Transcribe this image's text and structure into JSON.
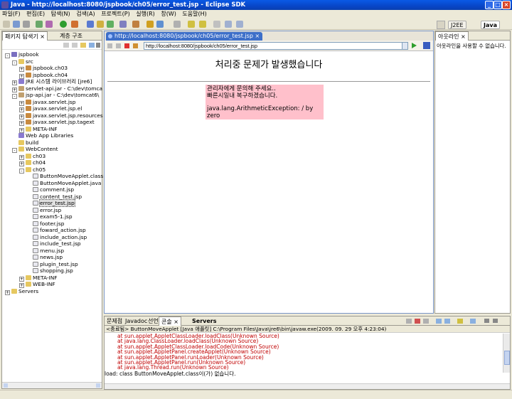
{
  "window": {
    "title": "Java - http://localhost:8080/jspbook/ch05/error_test.jsp - Eclipse SDK"
  },
  "menu": [
    "파일(F)",
    "편집(E)",
    "탐색(N)",
    "검색(A)",
    "프로젝트(P)",
    "실행(R)",
    "창(W)",
    "도움말(H)"
  ],
  "perspectives": {
    "j2ee": "J2EE",
    "java": "Java"
  },
  "left_tabs": [
    "패키지 탐색기",
    "계층 구조"
  ],
  "tree": [
    {
      "label": "jspbook",
      "indent": 0,
      "exp": "-",
      "icon": "project"
    },
    {
      "label": "src",
      "indent": 1,
      "exp": "-",
      "icon": "folder"
    },
    {
      "label": "jspbook.ch03",
      "indent": 2,
      "exp": "+",
      "icon": "package"
    },
    {
      "label": "jspbook.ch04",
      "indent": 2,
      "exp": "+",
      "icon": "package"
    },
    {
      "label": "JRE 시스템 라이브러리 [jre6]",
      "indent": 1,
      "exp": "+",
      "icon": "library"
    },
    {
      "label": "servlet-api.jar - C:\\dev\\tomca",
      "indent": 1,
      "exp": "+",
      "icon": "jar"
    },
    {
      "label": "jsp-api.jar - C:\\dev\\tomcat6\\",
      "indent": 1,
      "exp": "-",
      "icon": "jar"
    },
    {
      "label": "javax.servlet.jsp",
      "indent": 2,
      "exp": "+",
      "icon": "package"
    },
    {
      "label": "javax.servlet.jsp.el",
      "indent": 2,
      "exp": "+",
      "icon": "package"
    },
    {
      "label": "javax.servlet.jsp.resources",
      "indent": 2,
      "exp": "+",
      "icon": "package"
    },
    {
      "label": "javax.servlet.jsp.tagext",
      "indent": 2,
      "exp": "+",
      "icon": "package"
    },
    {
      "label": "META-INF",
      "indent": 2,
      "exp": "+",
      "icon": "folder"
    },
    {
      "label": "Web App Libraries",
      "indent": 1,
      "exp": "",
      "icon": "library"
    },
    {
      "label": "build",
      "indent": 1,
      "exp": "",
      "icon": "folder"
    },
    {
      "label": "WebContent",
      "indent": 1,
      "exp": "-",
      "icon": "folder"
    },
    {
      "label": "ch03",
      "indent": 2,
      "exp": "+",
      "icon": "folder"
    },
    {
      "label": "ch04",
      "indent": 2,
      "exp": "+",
      "icon": "folder"
    },
    {
      "label": "ch05",
      "indent": 2,
      "exp": "-",
      "icon": "folder"
    },
    {
      "label": "ButtonMoveApplet.class",
      "indent": 3,
      "exp": "",
      "icon": "file"
    },
    {
      "label": "ButtonMoveApplet.java",
      "indent": 3,
      "exp": "",
      "icon": "file"
    },
    {
      "label": "comment.jsp",
      "indent": 3,
      "exp": "",
      "icon": "file"
    },
    {
      "label": "content_test.jsp",
      "indent": 3,
      "exp": "",
      "icon": "file"
    },
    {
      "label": "error_test.jsp",
      "indent": 3,
      "exp": "",
      "icon": "file",
      "selected": true
    },
    {
      "label": "error.jsp",
      "indent": 3,
      "exp": "",
      "icon": "file"
    },
    {
      "label": "exam5-1.jsp",
      "indent": 3,
      "exp": "",
      "icon": "file"
    },
    {
      "label": "footer.jsp",
      "indent": 3,
      "exp": "",
      "icon": "file"
    },
    {
      "label": "foward_action.jsp",
      "indent": 3,
      "exp": "",
      "icon": "file"
    },
    {
      "label": "include_action.jsp",
      "indent": 3,
      "exp": "",
      "icon": "file"
    },
    {
      "label": "include_test.jsp",
      "indent": 3,
      "exp": "",
      "icon": "file"
    },
    {
      "label": "menu.jsp",
      "indent": 3,
      "exp": "",
      "icon": "file"
    },
    {
      "label": "news.jsp",
      "indent": 3,
      "exp": "",
      "icon": "file"
    },
    {
      "label": "plugin_test.jsp",
      "indent": 3,
      "exp": "",
      "icon": "file"
    },
    {
      "label": "shopping.jsp",
      "indent": 3,
      "exp": "",
      "icon": "file"
    },
    {
      "label": "META-INF",
      "indent": 2,
      "exp": "+",
      "icon": "folder"
    },
    {
      "label": "WEB-INF",
      "indent": 2,
      "exp": "+",
      "icon": "folder"
    },
    {
      "label": "Servers",
      "indent": 0,
      "exp": "+",
      "icon": "folder"
    }
  ],
  "editor": {
    "tab": "http://localhost:8080/jspbook/ch05/error_test.jsp",
    "url": "http://localhost:8080/jspbook/ch05/error_test.jsp",
    "heading": "처리중 문제가 발생했습니다",
    "msg1": "관리자에게 문의해 주세요..",
    "msg2": "빠른시일내 복구하겠습니다.",
    "exception": "java.lang.ArithmeticException: / by zero"
  },
  "outline": {
    "tab": "아웃라인",
    "message": "아웃라인을 사용할 수 없습니다."
  },
  "console": {
    "tabs": [
      "문제점",
      "Javadoc",
      "선언",
      "콘솔",
      "Servers"
    ],
    "header": "<종료됨> ButtonMoveApplet [Java 애플릿] C:\\Program Files\\Java\\jre6\\bin\\javaw.exe(2009. 09. 29 오후 4:23:04)",
    "trace": [
      "at sun.applet.AppletClassLoader.loadClass(Unknown Source)",
      "at java.lang.ClassLoader.loadClass(Unknown Source)",
      "at sun.applet.AppletClassLoader.loadCode(Unknown Source)",
      "at sun.applet.AppletPanel.createApplet(Unknown Source)",
      "at sun.applet.AppletPanel.runLoader(Unknown Source)",
      "at sun.applet.AppletPanel.run(Unknown Source)",
      "at java.lang.Thread.run(Unknown Source)"
    ],
    "load": "load: class ButtonMoveApplet.class이(가) 없습니다."
  }
}
